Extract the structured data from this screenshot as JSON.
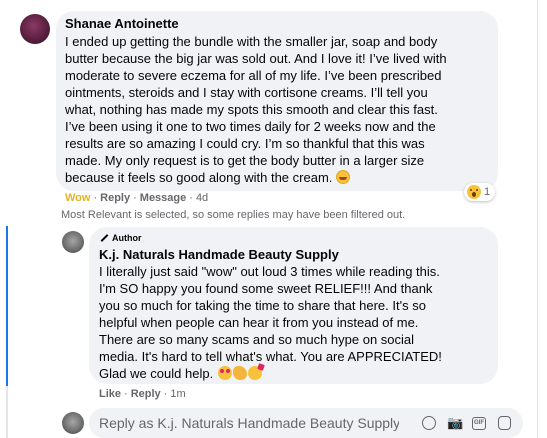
{
  "comment": {
    "author": "Shanae Antoinette",
    "text_lines": [
      "I ended up getting the bundle with the smaller jar, soap and body",
      "butter because the big jar was sold out. And I love it! I’ve lived with",
      "moderate to severe eczema for all of my life. I’ve been prescribed",
      "ointments, steroids and I stay with cortisone creams. I’ll tell you",
      "what, nothing has made my spots this smooth and clear this fast.",
      "I’ve been using it one to two times daily for 2 weeks now and the",
      "results are so amazing I could cry. I’m so thankful that this was",
      "made. My only request is to get the body butter in a larger size",
      "because it feels so good along with the cream."
    ],
    "trailing_emoji": "grinning-face-emoji",
    "actions": {
      "reaction_label": "Wow",
      "reply_label": "Reply",
      "message_label": "Message",
      "time": "4d"
    },
    "reaction_count": "1",
    "reaction_type": "wow"
  },
  "filter_notice": "Most Relevant is selected, so some replies may have been filtered out.",
  "reply": {
    "badge": "Author",
    "author": "K.j. Naturals Handmade Beauty Supply",
    "text_lines": [
      "I literally just said \"wow\" out loud 3 times while reading this.",
      "I'm SO happy you found some sweet RELIEF!!! And thank",
      "you so much for taking the time to share that here. It's so",
      "helpful when people can hear it from you instead of me.",
      "There are so many scams and so much hype on social",
      "media. It's hard to tell what's what. You are APPRECIATED!",
      "Glad we could help."
    ],
    "trailing_emojis": [
      "heart-eyes-emoji",
      "raising-hands-emoji",
      "partying-face-emoji"
    ],
    "actions": {
      "like_label": "Like",
      "reply_label": "Reply",
      "time": "1m"
    }
  },
  "composer": {
    "placeholder": "Reply as K.j. Naturals Handmade Beauty Supply",
    "tools": [
      "emoji-icon",
      "camera-icon",
      "gif-icon",
      "sticker-icon"
    ]
  },
  "colors": {
    "bubble": "#f0f2f5",
    "meta_text": "#65676b",
    "wow_accent": "#e3b422",
    "thread_accent": "#1877f2"
  }
}
